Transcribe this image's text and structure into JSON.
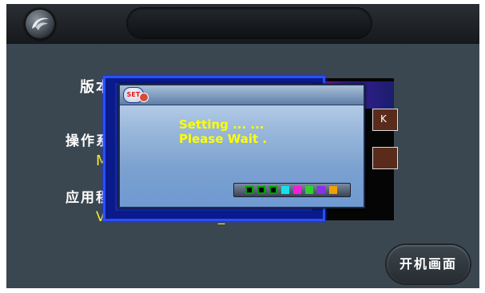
{
  "header": {
    "title": ""
  },
  "labels": {
    "version": "版本",
    "os": "操作系",
    "app": "应用程"
  },
  "values": {
    "os_partial": "M",
    "app_version": "V70.01.5AD27.CH_6001.2.C"
  },
  "boot_button_label": "开机画面",
  "popup": {
    "badge": "SET",
    "line1": "Setting ... ...",
    "line2": "Please Wait ."
  },
  "background_dialog": {
    "button_text": "K"
  },
  "progress": {
    "cells": [
      {
        "color": "#00a000",
        "done": true
      },
      {
        "color": "#00a000",
        "done": true
      },
      {
        "color": "#00a000",
        "done": true
      },
      {
        "color": "#18e0e8",
        "done": false
      },
      {
        "color": "#f020d8",
        "done": false
      },
      {
        "color": "#30d030",
        "done": false
      },
      {
        "color": "#8a30e8",
        "done": false
      },
      {
        "color": "#f0a000",
        "done": false
      }
    ]
  },
  "icons": {
    "home": "logo-swirl-icon",
    "badge": "set-badge-icon"
  },
  "colors": {
    "background": "#3b4750",
    "value_text": "#f4ef2a",
    "popup_text": "#ffff00"
  }
}
